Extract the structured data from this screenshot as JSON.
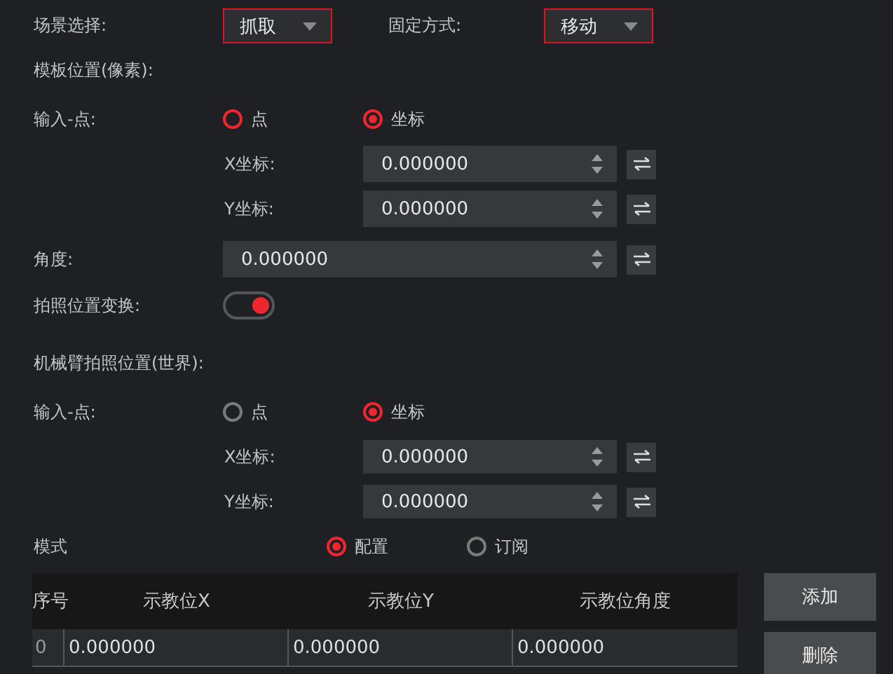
{
  "top": [
    {
      "label": "场景选择:",
      "value": "抓取"
    },
    {
      "label": "固定方式:",
      "value": "移动"
    }
  ],
  "sections": [
    {
      "title": "模板位置(像素):",
      "input": {
        "label": "输入-点:",
        "focused": true,
        "options": [
          {
            "label": "点",
            "selected": false
          },
          {
            "label": "坐标",
            "selected": true
          }
        ]
      },
      "coords": [
        {
          "label": "X坐标:",
          "value": "0.000000"
        },
        {
          "label": "Y坐标:",
          "value": "0.000000"
        }
      ],
      "angle": {
        "label": "角度:",
        "value": "0.000000"
      },
      "toggle": {
        "label": "拍照位置变换:",
        "on": true
      }
    },
    {
      "title": "机械臂拍照位置(世界):",
      "input": {
        "label": "输入-点:",
        "focused": false,
        "options": [
          {
            "label": "点",
            "selected": false
          },
          {
            "label": "坐标",
            "selected": true
          }
        ]
      },
      "coords": [
        {
          "label": "X坐标:",
          "value": "0.000000"
        },
        {
          "label": "Y坐标:",
          "value": "0.000000"
        }
      ]
    }
  ],
  "mode": {
    "label": "模式",
    "options": [
      {
        "label": "配置",
        "selected": true
      },
      {
        "label": "订阅",
        "selected": false
      }
    ]
  },
  "table": {
    "columns": [
      "序号",
      "示教位X",
      "示教位Y",
      "示教位角度"
    ],
    "rows": [
      [
        "0",
        "0.000000",
        "0.000000",
        "0.000000"
      ]
    ]
  },
  "buttons": [
    "添加",
    "删除"
  ]
}
